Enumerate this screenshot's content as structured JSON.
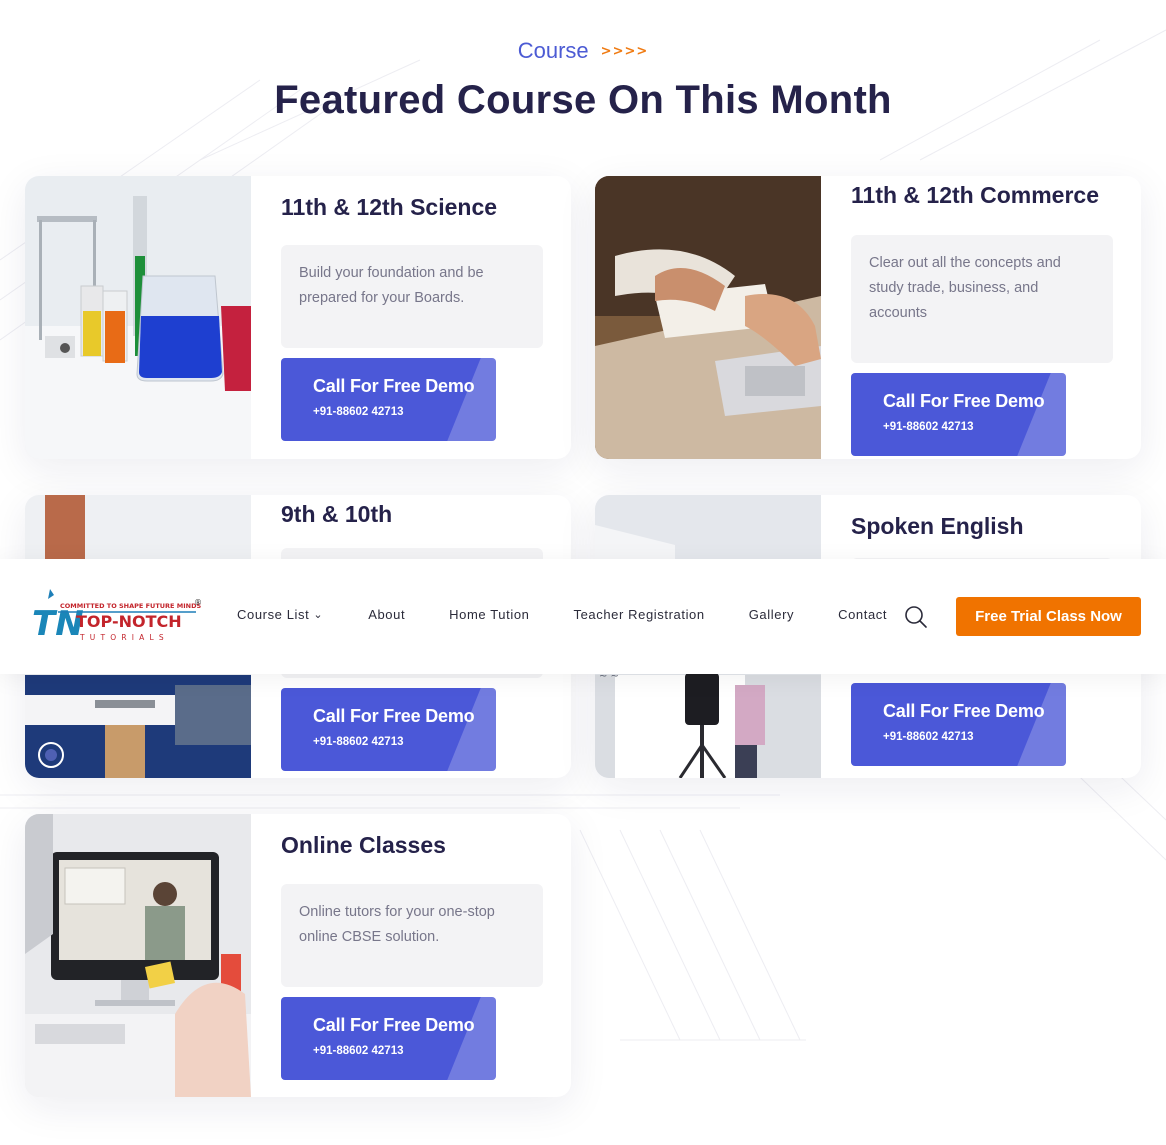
{
  "section": {
    "eyebrow": "Course",
    "eyebrow_arrows": ">>>>",
    "title": "Featured Course On This Month"
  },
  "courses": [
    {
      "title": "11th & 12th Science",
      "description": "Build your foundation and be prepared for your Boards.",
      "button_label": "Call For Free Demo",
      "phone": "+91-88602 42713",
      "image": "science-lab-beakers"
    },
    {
      "title": "11th & 12th Commerce",
      "description": "Clear out all the concepts and study trade, business, and accounts",
      "button_label": "Call For Free Demo",
      "phone": "+91-88602 42713",
      "image": "calculator-accounts"
    },
    {
      "title": "9th & 10th",
      "description": "",
      "button_label": "Call For Free Demo",
      "phone": "+91-88602 42713",
      "image": "classroom-students"
    },
    {
      "title": "Spoken English",
      "description": "",
      "button_label": "Call For Free Demo",
      "phone": "+91-88602 42713",
      "image": "video-recording-class"
    },
    {
      "title": "Online Classes",
      "description": "Online tutors for your one-stop online CBSE solution.",
      "button_label": "Call For Free Demo",
      "phone": "+91-88602 42713",
      "image": "online-lesson-monitor"
    }
  ],
  "navbar": {
    "logo": {
      "tagline": "COMMITTED TO SHAPE FUTURE MINDS",
      "name": "TOP-NOTCH",
      "sub": "TUTORIALS",
      "mark": "TN",
      "registered": "®"
    },
    "items": [
      {
        "label": "Course List",
        "has_dropdown": true
      },
      {
        "label": "About"
      },
      {
        "label": "Home Tution"
      },
      {
        "label": "Teacher Registration"
      },
      {
        "label": "Gallery"
      },
      {
        "label": "Contact"
      }
    ],
    "search_icon": "search-icon",
    "cta_label": "Free Trial Class Now",
    "dropdown_glyph": "⌄"
  },
  "colors": {
    "primary_blue": "#4b58d8",
    "accent_orange": "#f07300",
    "title_dark": "#25224a"
  }
}
